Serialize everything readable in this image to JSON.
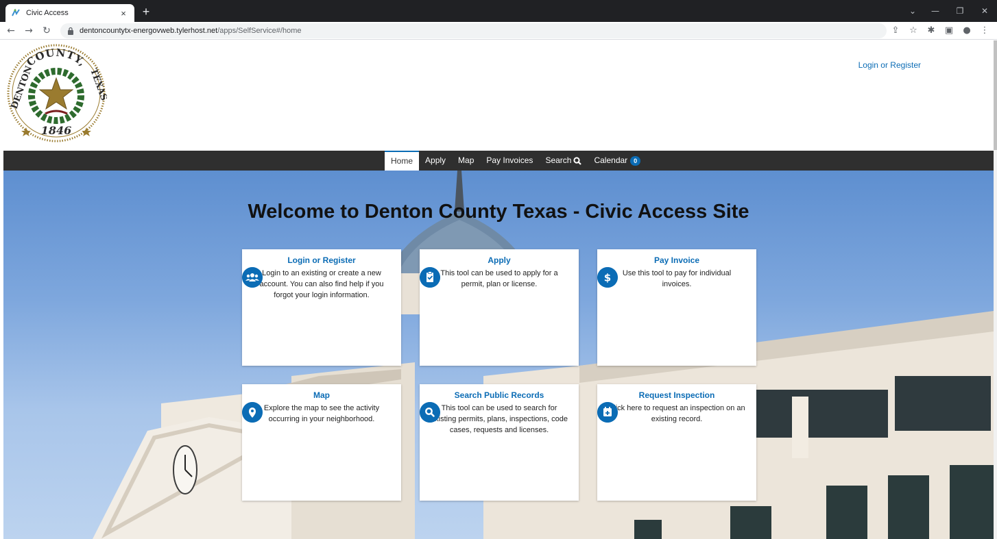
{
  "browser": {
    "tab_title": "Civic Access",
    "tab_close": "×",
    "new_tab": "+",
    "url_host": "dentoncountytx-energovweb.tylerhost.net",
    "url_path": "/apps/SelfService#/home"
  },
  "seal": {
    "text_top": "COUNTY,",
    "text_left": "DENTON",
    "text_right": "TEXAS",
    "year": "1846"
  },
  "header": {
    "login_link": "Login or Register"
  },
  "nav": {
    "items": [
      {
        "label": "Home"
      },
      {
        "label": "Apply"
      },
      {
        "label": "Map"
      },
      {
        "label": "Pay Invoices"
      },
      {
        "label": "Search"
      },
      {
        "label": "Calendar"
      }
    ],
    "calendar_badge": "0",
    "active": "Home"
  },
  "hero": {
    "title": "Welcome to Denton County Texas - Civic Access Site"
  },
  "cards": [
    {
      "icon": "users-icon",
      "title": "Login or Register",
      "desc": "Login to an existing or create a new account. You can also find help if you forgot your login information."
    },
    {
      "icon": "clipboard-check-icon",
      "title": "Apply",
      "desc": "This tool can be used to apply for a permit, plan or license."
    },
    {
      "icon": "dollar-icon",
      "title": "Pay Invoice",
      "desc": "Use this tool to pay for individual invoices."
    },
    {
      "icon": "map-pin-icon",
      "title": "Map",
      "desc": "Explore the map to see the activity occurring in your neighborhood."
    },
    {
      "icon": "search-icon",
      "title": "Search Public Records",
      "desc": "This tool can be used to search for existing permits, plans, inspections, code cases, requests and licenses."
    },
    {
      "icon": "calendar-plus-icon",
      "title": "Request Inspection",
      "desc": "Click here to request an inspection on an existing record."
    }
  ],
  "colors": {
    "accent": "#0b6cb5",
    "navbar": "#2f2f2f",
    "seal_gold": "#9a7b2f",
    "seal_green": "#2e6b2e"
  }
}
